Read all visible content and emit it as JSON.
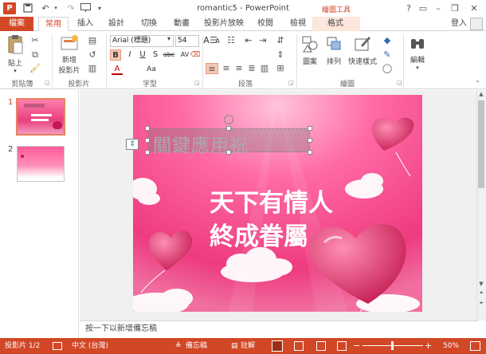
{
  "title": {
    "app_logo": "P",
    "document": "romantic5 - PowerPoint",
    "context_group": "繪圖工具",
    "help": "?",
    "minimize": "–",
    "restore": "❐",
    "close": "✕"
  },
  "tabs": {
    "file": "檔案",
    "home": "常用",
    "insert": "插入",
    "design": "設計",
    "transitions": "切換",
    "animations": "動畫",
    "slideshow": "投影片放映",
    "review": "校閱",
    "view": "檢視",
    "format": "格式",
    "login": "登入"
  },
  "ribbon": {
    "paste": "貼上",
    "new_slide_line1": "新增",
    "new_slide_line2": "投影片",
    "font_name": "Arial (標題)",
    "font_size": "54",
    "bold": "B",
    "italic": "I",
    "underline": "U",
    "strike": "S",
    "abc": "abc",
    "av": "AV",
    "aa": "Aa",
    "grow": "A",
    "shrink": "A",
    "font_color": "A",
    "shapes": "圖案",
    "arrange": "排列",
    "quick_styles": "快速樣式",
    "edit": "編輯",
    "groups": {
      "clipboard": "剪貼簿",
      "slides": "投影片",
      "font": "字型",
      "paragraph": "段落",
      "drawing": "繪圖"
    }
  },
  "thumbnails": [
    {
      "num": "1"
    },
    {
      "num": "2"
    }
  ],
  "slide": {
    "title_placeholder": "關鍵應用祝",
    "line1": "天下有情人",
    "line2": "終成眷屬"
  },
  "notes_placeholder": "按一下以新增備忘稿",
  "status": {
    "slide_info": "投影片 1/2",
    "language": "中文 (台灣)",
    "notes": "備忘稿",
    "comments": "註解",
    "zoom_minus": "−",
    "zoom_plus": "+",
    "zoom": "50%"
  },
  "colors": {
    "accent": "#d24726",
    "slide_pink": "#e8407c"
  }
}
